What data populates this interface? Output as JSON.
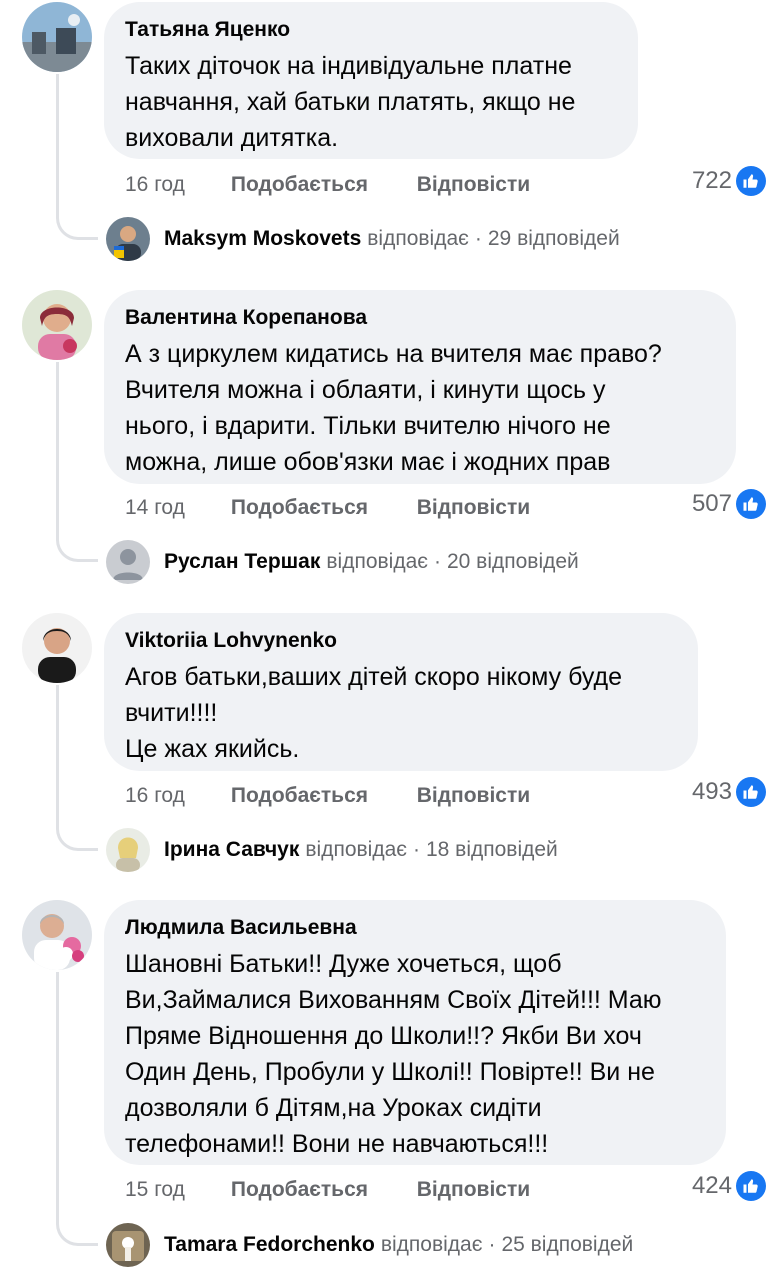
{
  "comments": [
    {
      "author": "Татьяна Яценко",
      "text": "Таких діточок на індивідуальне платне\nнавчання, хай батьки платять, якщо не\nвиховали дитятка.",
      "time": "16 год",
      "like_label": "Подобається",
      "reply_label": "Відповісти",
      "reactions": "722",
      "reply_author": "Maksym Moskovets",
      "reply_verb": "відповідає",
      "reply_count": "29 відповідей"
    },
    {
      "author": "Валентина Корепанова",
      "text": "А з циркулем кидатись на вчителя має право?\nВчителя можна і облаяти, і кинути щось у\nнього, і вдарити. Тільки вчителю нічого не\nможна, лише обов'язки має і жодних прав",
      "time": "14 год",
      "like_label": "Подобається",
      "reply_label": "Відповісти",
      "reactions": "507",
      "reply_author": "Руслан Тершак",
      "reply_verb": "відповідає",
      "reply_count": "20 відповідей"
    },
    {
      "author": "Viktoriia Lohvynenko",
      "text": "Агов батьки,ваших дітей скоро нікому буде\nвчити!!!!\nЦе жах якийсь.",
      "time": "16 год",
      "like_label": "Подобається",
      "reply_label": "Відповісти",
      "reactions": "493",
      "reply_author": "Ірина Савчук",
      "reply_verb": "відповідає",
      "reply_count": "18 відповідей"
    },
    {
      "author": "Людмила Васильевна",
      "text": "Шановні Батьки!! Дуже хочеться, щоб\nВи,Займалися Вихованням Своїх Дітей!!! Маю\nПряме Відношення до Школи!!? Якби Ви хоч\nОдин День, Пробули у Школі!! Повірте!! Ви не\nдозволяли б Дітям,на Уроках сидіти\nтелефонами!! Вони не навчаються!!!",
      "time": "15 год",
      "like_label": "Подобається",
      "reply_label": "Відповісти",
      "reactions": "424",
      "reply_author": "Tamara Fedorchenko",
      "reply_verb": "відповідає",
      "reply_count": "25 відповідей"
    }
  ],
  "icons": {
    "reaction": "like-thumb-icon"
  },
  "colors": {
    "bubble": "#f0f2f5",
    "secondary_text": "#65676b",
    "like_blue": "#1877f2"
  }
}
